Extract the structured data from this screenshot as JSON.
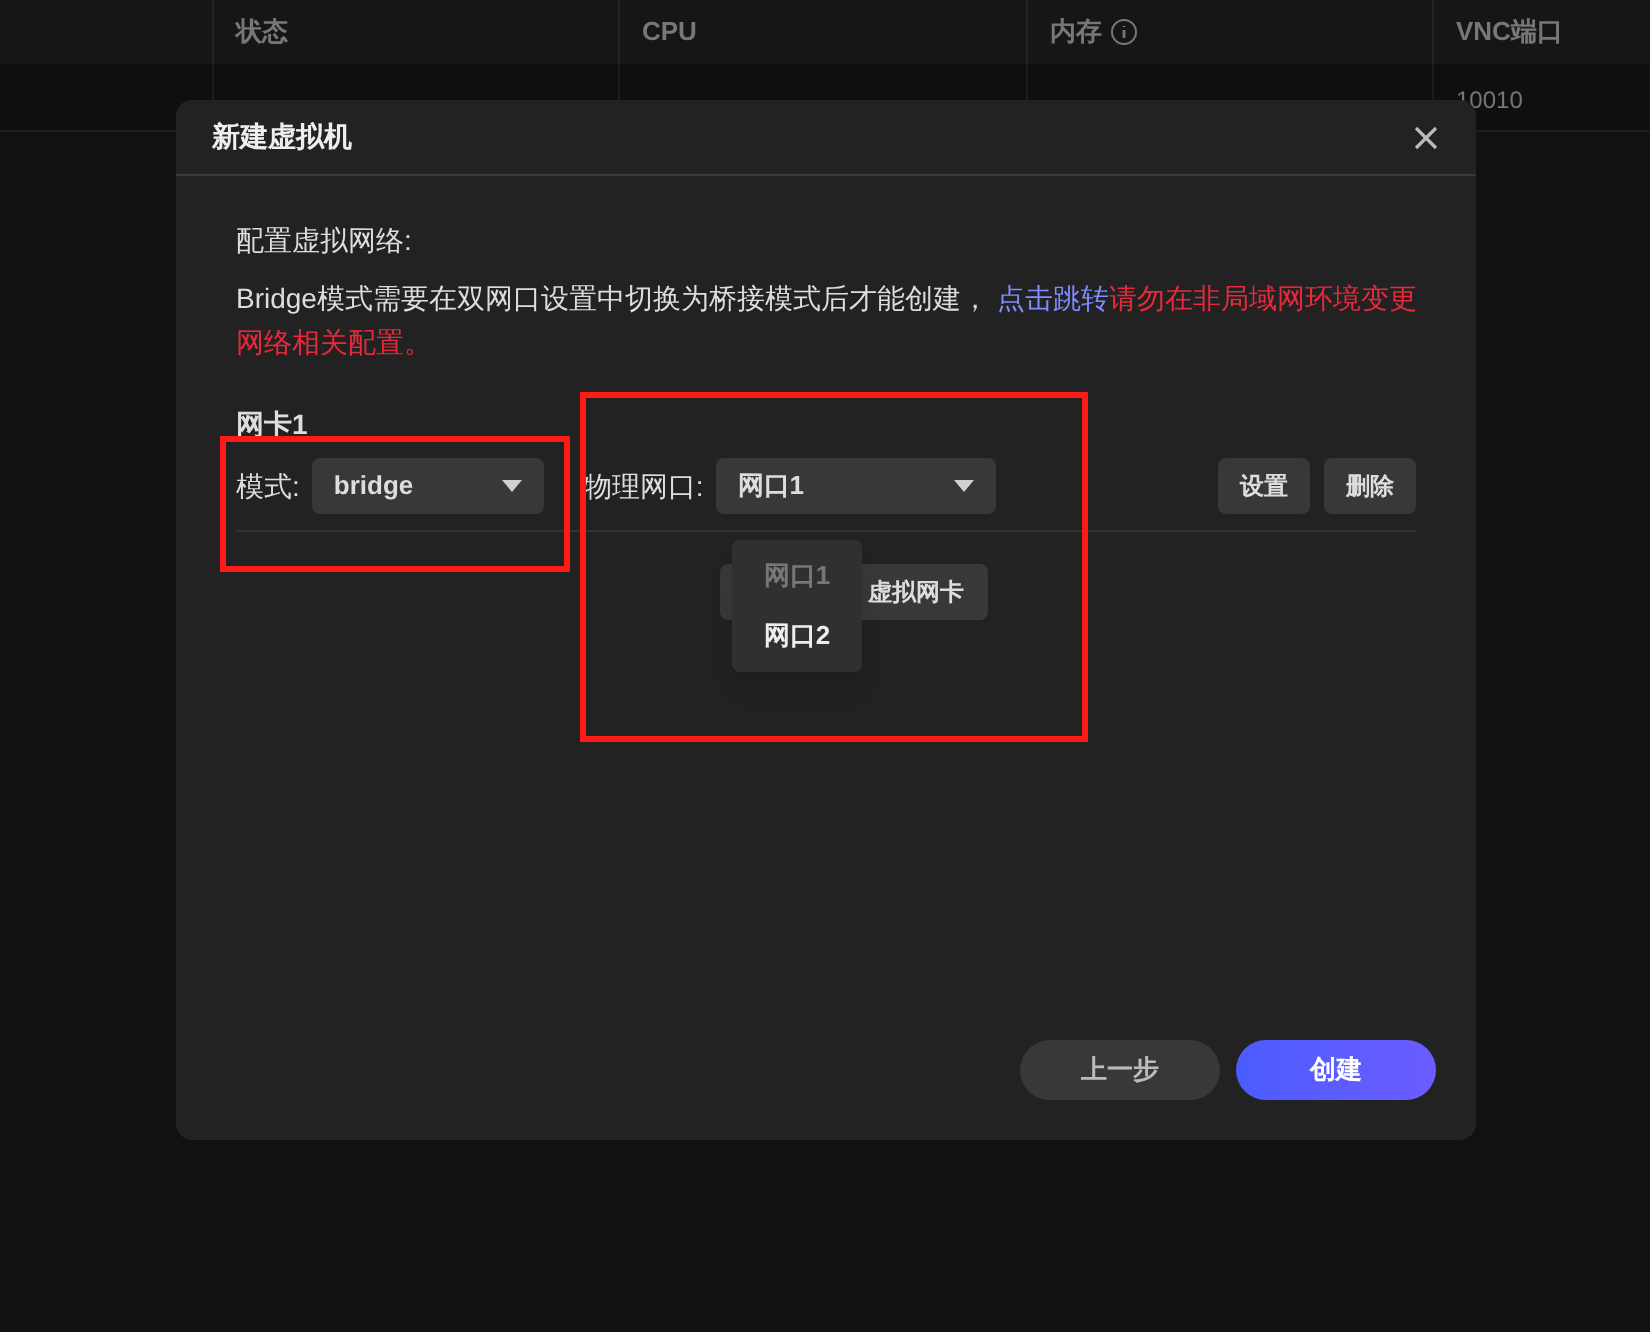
{
  "table": {
    "columns": [
      "状态",
      "CPU",
      "内存",
      "VNC端口"
    ],
    "rows": [
      {
        "vnc_port": "10010"
      }
    ]
  },
  "dialog": {
    "title": "新建虚拟机",
    "section_label": "配置虚拟网络:",
    "notice": {
      "text": "Bridge模式需要在双网口设置中切换为桥接模式后才能创建，",
      "link": "点击跳转",
      "warning": "请勿在非局域网环境变更网络相关配置。"
    },
    "nics": [
      {
        "title": "网卡1",
        "mode_label": "模式:",
        "mode": "bridge",
        "port_label": "物理网口:",
        "port": "网口1",
        "buttons": [
          "设置",
          "删除"
        ],
        "port_options": [
          {
            "label": "网口1",
            "selected": true
          },
          {
            "label": "网口2",
            "selected": false
          }
        ]
      }
    ],
    "add_button": "虚拟网卡",
    "footer": {
      "back": "上一步",
      "create": "创建"
    }
  }
}
